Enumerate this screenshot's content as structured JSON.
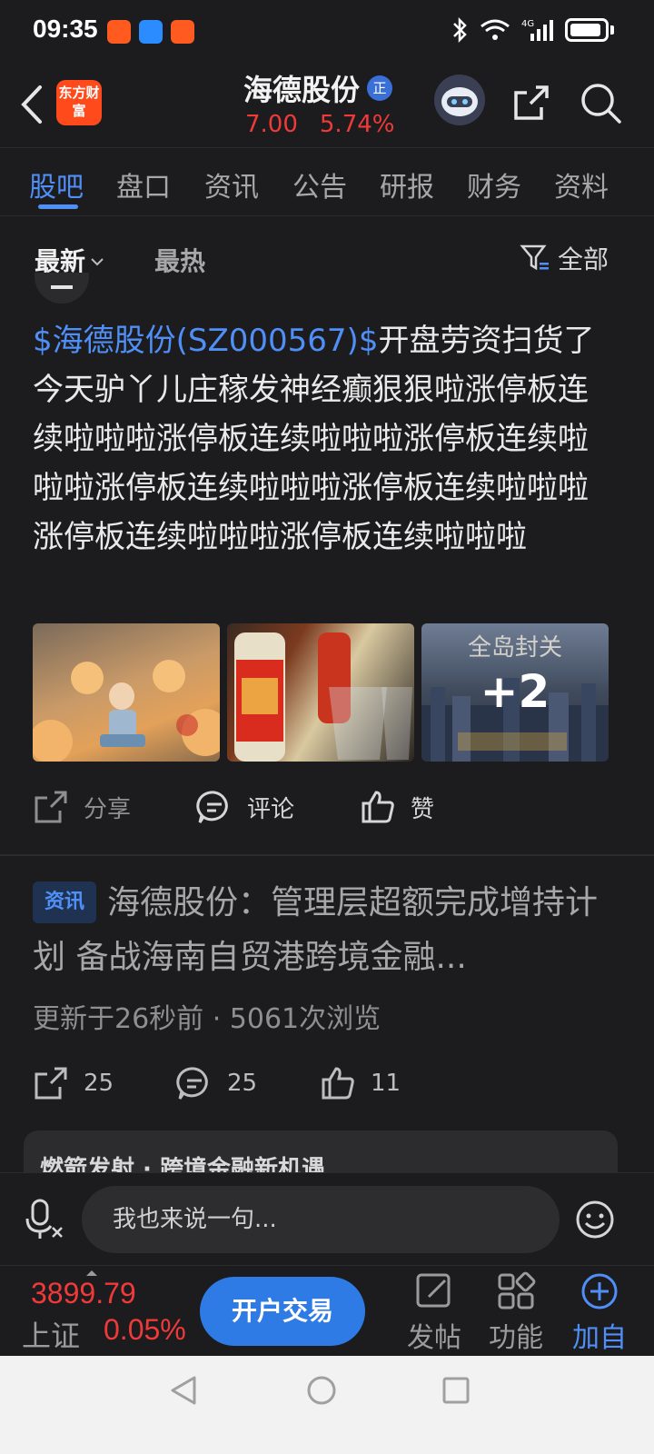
{
  "status_bar": {
    "time": "09:35"
  },
  "header": {
    "logo_text": "东方财富",
    "stock_name": "海德股份",
    "badge": "正",
    "price": "7.00",
    "change_pct": "5.74%"
  },
  "tabs": [
    "股吧",
    "盘口",
    "资讯",
    "公告",
    "研报",
    "财务",
    "资料"
  ],
  "sort": {
    "latest": "最新",
    "hot": "最热",
    "filter": "全部"
  },
  "post": {
    "stock_link": "$海德股份(SZ000567)$",
    "body": "开盘劳资扫货了今天驴丫儿庄稼发神经癫狠狠啦涨停板连续啦啦啦涨停板连续啦啦啦涨停板连续啦啦啦涨停板连续啦啦啦涨停板连续啦啦啦涨停板连续啦啦啦涨停板连续啦啦啦",
    "image3_title": "全岛封关",
    "more_images": "+2",
    "share_label": "分享",
    "comment_label": "评论",
    "like_label": "赞"
  },
  "news": {
    "tag": "资讯",
    "title": "海德股份：管理层超额完成增持计划 备战海南自贸港跨境金融...",
    "meta": "更新于26秒前 · 5061次浏览",
    "shares": "25",
    "comments": "25",
    "likes": "11",
    "card_peek": "燃箭发射 · 跨境金融新机遇"
  },
  "comment_bar": {
    "placeholder": "我也来说一句..."
  },
  "toolbar": {
    "index_value": "3899.79",
    "index_name": "上证",
    "index_pct": "0.05%",
    "open_account": "开户交易",
    "post_label": "发帖",
    "function_label": "功能",
    "add_label": "加自"
  },
  "colors": {
    "accent": "#4f8ff7",
    "up": "#f03a3a",
    "bg": "#1c1c1e"
  }
}
